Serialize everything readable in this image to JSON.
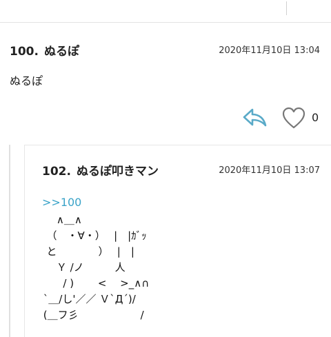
{
  "comments": [
    {
      "number": "100.",
      "name": "ぬるぽ",
      "date": "2020年11月10日 13:04",
      "body": "ぬるぽ",
      "like_count": "0",
      "icons": {
        "reply": "reply-icon",
        "like": "heart-outline-icon"
      }
    }
  ],
  "replies": [
    {
      "number": "102.",
      "name": "ぬるぽ叩きマン",
      "date": "2020年11月10日 13:07",
      "anchor": ">>100",
      "ascii_art": [
        "     ∧＿∧",
        "  （　・∀・）　 |　|ｶﾞｯ",
        "  と　　　　）　 |　|",
        "     Ｙ /ノ　　　人",
        "       / )　　 <　 >_∧∩",
        " `＿/し'／／ Ｖ`Д´)/",
        " (＿フ彡　　　　　　/"
      ]
    }
  ],
  "colors": {
    "link": "#3aa3c8",
    "icon": "#5aaac8",
    "heart": "#777777",
    "divider": "#e2e2e2"
  }
}
